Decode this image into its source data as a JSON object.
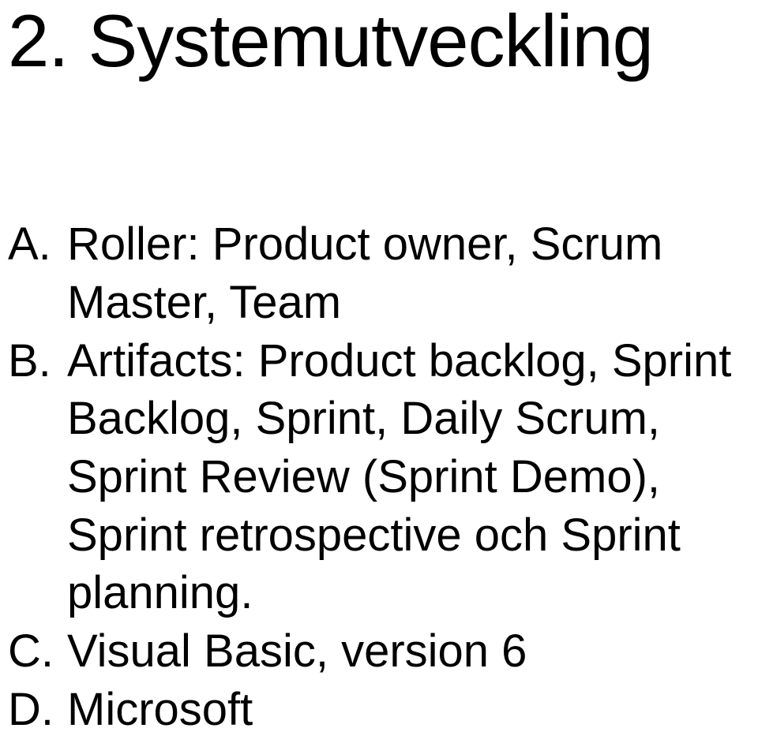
{
  "heading": "2. Systemutveckling",
  "items": [
    {
      "marker": "A.",
      "text": "Roller: Product owner, Scrum Master, Team"
    },
    {
      "marker": "B.",
      "text": "Artifacts: Product backlog, Sprint Backlog, Sprint, Daily Scrum, Sprint Review (Sprint Demo), Sprint retrospective och Sprint planning."
    },
    {
      "marker": "C.",
      "text": "Visual Basic, version 6"
    },
    {
      "marker": "D.",
      "text": "Microsoft"
    }
  ]
}
